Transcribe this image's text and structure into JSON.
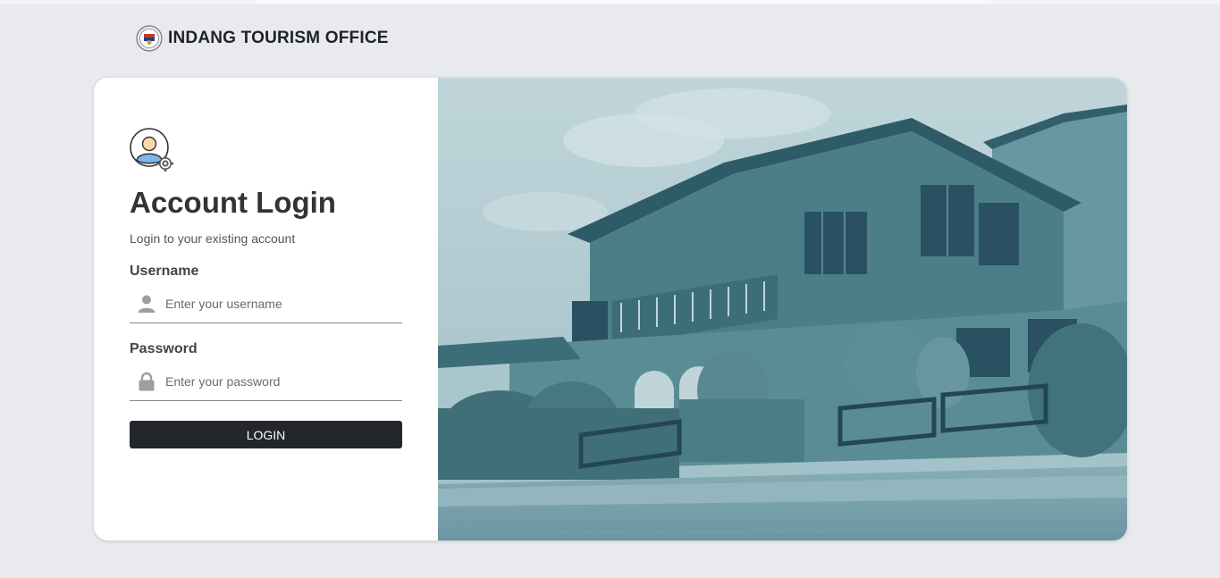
{
  "brand": {
    "name": "INDANG TOURISM OFFICE",
    "logo_icon": "municipal-seal-icon"
  },
  "login": {
    "avatar_icon": "user-settings-icon",
    "title": "Account Login",
    "subtitle": "Login to your existing account",
    "username_label": "Username",
    "username_placeholder": "Enter your username",
    "username_value": "",
    "username_icon": "user-icon",
    "password_label": "Password",
    "password_placeholder": "Enter your password",
    "password_value": "",
    "password_icon": "lock-icon",
    "login_button": "LOGIN"
  },
  "hero": {
    "image": "heritage-house-photo",
    "tint_color": "#4f8a98"
  },
  "colors": {
    "background": "#e9eaed",
    "button": "#23262b",
    "photo_tint": "#4f8a98"
  }
}
